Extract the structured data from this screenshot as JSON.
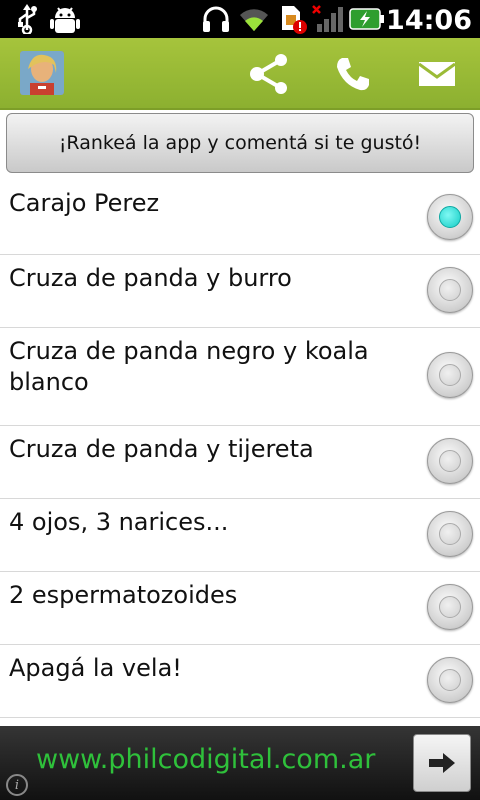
{
  "status": {
    "time": "14:06"
  },
  "app": {
    "rate_button_label": "¡Rankeá la app y comentá si te gustó!"
  },
  "options": [
    {
      "label": "Carajo Perez",
      "selected": true
    },
    {
      "label": "Cruza de panda y burro",
      "selected": false
    },
    {
      "label": "Cruza de panda negro y koala blanco",
      "selected": false
    },
    {
      "label": "Cruza de panda y tijereta",
      "selected": false
    },
    {
      "label": "4 ojos, 3 narices...",
      "selected": false
    },
    {
      "label": "2 espermatozoides",
      "selected": false
    },
    {
      "label": "Apagá la vela!",
      "selected": false
    }
  ],
  "ad": {
    "url": "www.philcodigital.com.ar"
  },
  "colors": {
    "actionbar": "#9bbb37",
    "radio_selected": "#19d4cc",
    "ad_text": "#2fc13b"
  }
}
